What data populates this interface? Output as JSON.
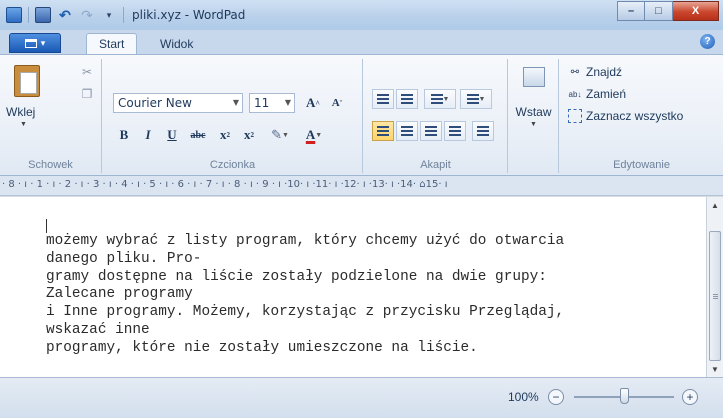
{
  "window": {
    "title": "pliki.xyz - WordPad",
    "minimize": "–",
    "maximize": "□",
    "close": "X"
  },
  "tabs": {
    "start": "Start",
    "view": "Widok",
    "help": "?"
  },
  "clipboard": {
    "paste": "Wklej",
    "group_label": "Schowek"
  },
  "font": {
    "family": "Courier New",
    "size": "11",
    "grow": "A",
    "shrink": "A",
    "bold": "B",
    "italic": "I",
    "underline": "U",
    "strike": "abc",
    "subscript": "x",
    "superscript": "x",
    "color": "A",
    "group_label": "Czcionka"
  },
  "paragraph": {
    "group_label": "Akapit"
  },
  "insert": {
    "label": "Wstaw"
  },
  "editing": {
    "find": "Znajdź",
    "replace": "Zamień",
    "select_all": "Zaznacz wszystko",
    "group_label": "Edytowanie"
  },
  "ruler": "· 8 · ı · 1 · ı · 2 · ı · 3 · ı · 4 · ı · 5 · ı · 6 · ı · 7 · ı · 8 · ı · 9 · ı ·10· ı ·11· ı ·12· ı ·13· ı ·14· ⌂15· ı",
  "document": {
    "lines": [
      "możemy wybrać z listy program, który chcemy użyć do otwarcia",
      "danego pliku. Pro-",
      "gramy dostępne na liście zostały podzielone na dwie grupy:",
      "Zalecane programy",
      "i Inne programy. Możemy, korzystając z przycisku Przeglądaj,",
      "wskazać inne",
      "programy, które nie zostały umieszczone na liście."
    ]
  },
  "status": {
    "zoom": "100%",
    "zoom_out": "−",
    "zoom_in": "+",
    "zoom_level": 1.0
  }
}
